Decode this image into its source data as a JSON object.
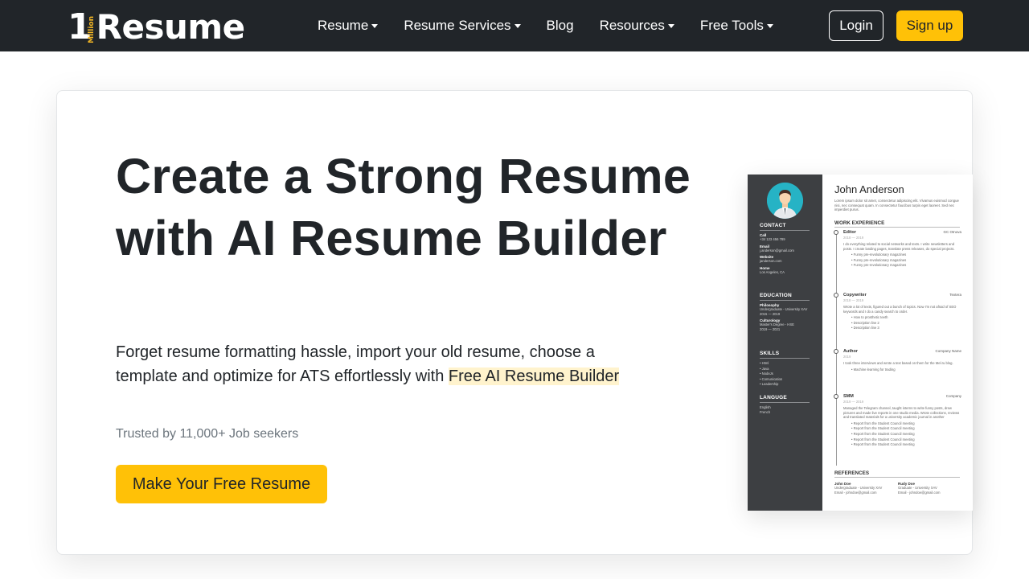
{
  "logo": {
    "one": "1",
    "million": "Million",
    "resume": "Resume"
  },
  "nav": {
    "items": [
      {
        "label": "Resume",
        "dropdown": true
      },
      {
        "label": "Resume Services",
        "dropdown": true
      },
      {
        "label": "Blog",
        "dropdown": false
      },
      {
        "label": "Resources",
        "dropdown": true
      },
      {
        "label": "Free Tools",
        "dropdown": true
      }
    ],
    "login": "Login",
    "signup": "Sign up"
  },
  "hero": {
    "title": "Create a Strong Resume with AI Resume Builder",
    "desc_prefix": "Forget resume formatting hassle, import your old resume, choose a template and optimize for ATS effortlessly with ",
    "desc_highlight": "Free AI Resume Builder",
    "trusted": "Trusted by 11,000+ Job seekers",
    "cta": "Make Your Free Resume"
  },
  "resume": {
    "name": "John Anderson",
    "intro": "Lorem ipsum dolor sit amet, consectetur adipiscing elit. Vivamus euismod congue nisi, nec consequat quam. In consectetur faucibus turpis eget laoreet. Sed nec imperdiet purus.",
    "contact_title": "CONTACT",
    "contact": [
      {
        "label": "Call",
        "value": "+34 123 456 789"
      },
      {
        "label": "Email",
        "value": "j.anderson@gmail.com"
      },
      {
        "label": "Website",
        "value": "janderson.com"
      },
      {
        "label": "Home",
        "value": "Los Angeles, CA"
      }
    ],
    "education_title": "EDUCATION",
    "education": [
      {
        "label": "Philosophy",
        "lines": [
          "Undergraduate - University XAV",
          "2015 — 2019"
        ]
      },
      {
        "label": "Culturology",
        "lines": [
          "Master's Degree - HSE",
          "2019 — 2021"
        ]
      }
    ],
    "skills_title": "SKILLS",
    "skills": [
      "Html",
      "Java",
      "NodeJs",
      "Comunication",
      "Leadership"
    ],
    "language_title": "LANGUGE",
    "languages": [
      "English",
      "French"
    ],
    "work_title": "WORK EXPERIENCE",
    "jobs": [
      {
        "title": "Editor",
        "company": "GC Otnova",
        "date": "2018 — 2019",
        "desc": "I do everything related to social networks and texts. I write newsletters and posts. I create landing pages, translate press releases, do special projects.",
        "bullets": [
          "Funny pre-revolutionary magazines",
          "Funny pre-revolutionary magazines",
          "Funny pre-revolutionary magazines"
        ]
      },
      {
        "title": "Copywriter",
        "company": "Textera",
        "date": "2018 — 2019",
        "desc": "Wrote a lot of texts, figured out a bunch of topics. Now I'm not afraid of SEO keywords and I do a candy search to order.",
        "bullets": [
          "How to prosthetic teeth",
          "Description line 2",
          "Description line 3"
        ]
      },
      {
        "title": "Author",
        "company": "Company Name",
        "date": "2019",
        "desc": "I took three interviews and wrote a text based on them for the Mel.ru blog.",
        "bullets": [
          "Machine learning for trading"
        ]
      },
      {
        "title": "SMM",
        "company": "Company",
        "date": "2019 — 2019",
        "desc": "Managed the Telegram channel, taught interns to write funny posts, drew pictures and made live reports in one studio media. Wrote collections, reviews and translated materials for a university academic journal in another",
        "bullets": [
          "Report from the Student Council meeting",
          "Report from the Student Council meeting",
          "Report from the Student Council meeting",
          "Report from the Student Council meeting",
          "Report from the Student Council meeting"
        ]
      }
    ],
    "references_title": "REFERENCES",
    "references": [
      {
        "name": "John Doe",
        "lines": [
          "Undergraduate - University XAV",
          "Email - johndoe@gmail.com"
        ]
      },
      {
        "name": "Rudy Doe",
        "lines": [
          "Graduate - University XAV",
          "Email - johndoe@gmail.com"
        ]
      }
    ]
  }
}
